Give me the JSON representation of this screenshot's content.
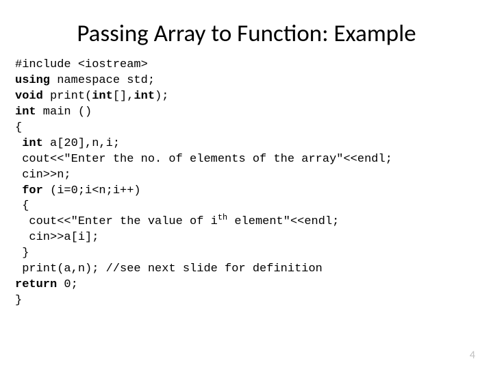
{
  "title": "Passing Array to Function: Example",
  "code": {
    "l1_a": "#include <iostream>",
    "l2_a": "using",
    "l2_b": " namespace std;",
    "l3_a": "void",
    "l3_b": " print(",
    "l3_c": "int",
    "l3_d": "[],",
    "l3_e": "int",
    "l3_f": ");",
    "l4_a": "int",
    "l4_b": " main ()",
    "l5_a": "{",
    "l6_a": " int",
    "l6_b": " a[20],n,i;",
    "l7_a": " cout<<\"Enter the no. of elements of the array\"<<endl;",
    "l8_a": " cin>>n;",
    "l9_a": " for",
    "l9_b": " (i=0;i<n;i++)",
    "l10_a": " {",
    "l11_a": "  cout<<\"Enter the value of i",
    "l11_b": "th",
    "l11_c": " element\"<<endl;",
    "l12_a": "  cin>>a[i];",
    "l13_a": " }",
    "l14_a": " print(a,n); ",
    "l14_b": "//see next slide for definition",
    "l15_a": "return",
    "l15_b": " 0;",
    "l16_a": "}"
  },
  "page_number": "4"
}
